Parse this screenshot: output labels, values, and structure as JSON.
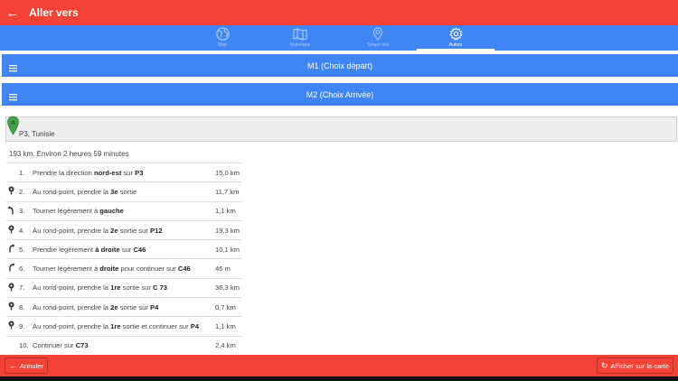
{
  "header": {
    "title": "Aller vers",
    "back_icon": "arrow-left-icon"
  },
  "tabs": [
    {
      "label": "Map",
      "icon": "globe-icon",
      "active": false
    },
    {
      "label": "Historique",
      "icon": "map-icon",
      "active": false
    },
    {
      "label": "Temps réel",
      "icon": "location-pin-icon",
      "active": false
    },
    {
      "label": "Autres",
      "icon": "gear-icon",
      "active": true
    }
  ],
  "choices": {
    "start": "M1 (Choix départ)",
    "end": "M2 (Choix Arrivée)"
  },
  "destination": {
    "marker": "A",
    "text": "P3, Tunisie"
  },
  "summary": "193 km. Environ 2 heures 59 minutes",
  "steps": [
    {
      "num": "1.",
      "icon": "",
      "parts": [
        [
          "Prendre la direction ",
          false
        ],
        [
          "nord-est",
          true
        ],
        [
          " sur ",
          false
        ],
        [
          "P3",
          true
        ]
      ],
      "dist": "15,0 km"
    },
    {
      "num": "2.",
      "icon": "roundabout-icon",
      "parts": [
        [
          "Au rond-point, prendre la ",
          false
        ],
        [
          "3e",
          true
        ],
        [
          " sortie",
          false
        ]
      ],
      "dist": "11,7 km"
    },
    {
      "num": "3.",
      "icon": "turn-left-icon",
      "parts": [
        [
          "Tourner légèrement à ",
          false
        ],
        [
          "gauche",
          true
        ]
      ],
      "dist": "1,1 km"
    },
    {
      "num": "4.",
      "icon": "roundabout-icon",
      "parts": [
        [
          "Au rond-point, prendre la ",
          false
        ],
        [
          "2e",
          true
        ],
        [
          " sortie sur ",
          false
        ],
        [
          "P12",
          true
        ]
      ],
      "dist": "19,3 km"
    },
    {
      "num": "5.",
      "icon": "turn-right-icon",
      "parts": [
        [
          "Prendre légèrement ",
          false
        ],
        [
          "à droite",
          true
        ],
        [
          " sur ",
          false
        ],
        [
          "C46",
          true
        ]
      ],
      "dist": "10,1 km"
    },
    {
      "num": "6.",
      "icon": "turn-right-icon",
      "parts": [
        [
          "Tourner légèrement à ",
          false
        ],
        [
          "droite",
          true
        ],
        [
          " pour continuer sur ",
          false
        ],
        [
          "C46",
          true
        ]
      ],
      "dist": "46 m"
    },
    {
      "num": "7.",
      "icon": "roundabout-icon",
      "parts": [
        [
          "Au rond-point, prendre la ",
          false
        ],
        [
          "1re",
          true
        ],
        [
          " sortie sur ",
          false
        ],
        [
          "C 73",
          true
        ]
      ],
      "dist": "36,3 km"
    },
    {
      "num": "8.",
      "icon": "roundabout-icon",
      "parts": [
        [
          "Au rond-point, prendre la ",
          false
        ],
        [
          "2e",
          true
        ],
        [
          " sortie sur ",
          false
        ],
        [
          "P4",
          true
        ]
      ],
      "dist": "0,7 km"
    },
    {
      "num": "9.",
      "icon": "roundabout-icon",
      "parts": [
        [
          "Au rond-point, prendre la ",
          false
        ],
        [
          "1re",
          true
        ],
        [
          " sortie et continuer sur ",
          false
        ],
        [
          "P4",
          true
        ]
      ],
      "dist": "1,1 km"
    },
    {
      "num": "10.",
      "icon": "",
      "parts": [
        [
          "Continuer sur ",
          false
        ],
        [
          "C73",
          true
        ]
      ],
      "dist": "2,4 km"
    }
  ],
  "footer": {
    "cancel": "Annuler",
    "show_map": "Afficher sur la carte"
  },
  "colors": {
    "red": "#f44336",
    "blue": "#3f85f4",
    "pin_green": "#43a047"
  }
}
